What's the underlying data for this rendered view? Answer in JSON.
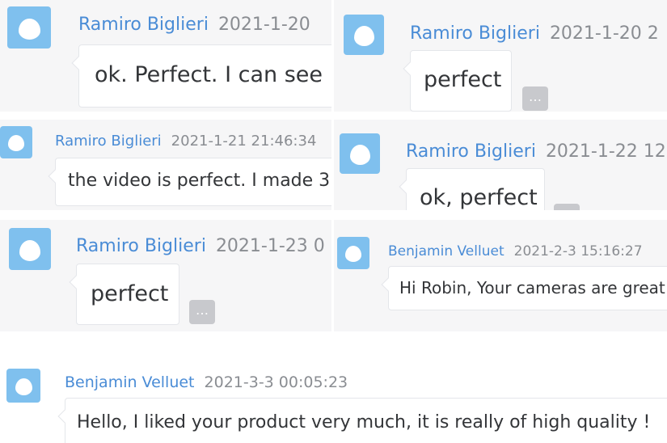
{
  "messages": [
    {
      "name": "Ramiro Biglieri",
      "time": "2021-1-20",
      "text": "ok. Perfect. I can see"
    },
    {
      "name": "Ramiro Biglieri",
      "time": "2021-1-20 2",
      "text": "perfect"
    },
    {
      "name": "Ramiro Biglieri",
      "time": "2021-1-21 21:46:34",
      "text": "the video is perfect. I made 3"
    },
    {
      "name": "Ramiro Biglieri",
      "time": "2021-1-22 12",
      "text": "ok, perfect"
    },
    {
      "name": "Ramiro Biglieri",
      "time": "2021-1-23 0",
      "text": "perfect"
    },
    {
      "name": "Benjamin Velluet",
      "time": "2021-2-3 15:16:27",
      "text": "Hi Robin, Your cameras are great!"
    },
    {
      "name": "Benjamin Velluet",
      "time": "2021-3-3 00:05:23",
      "text": "Hello, I liked your product very much, it is really of high quality !"
    }
  ],
  "icons": {
    "avatar": "user-avatar-icon",
    "more": "more-options-icon"
  },
  "colors": {
    "name": "#4a8cd6",
    "time": "#8a8d92",
    "avatar": "#7fc0ee",
    "tile": "#f6f6f7"
  }
}
